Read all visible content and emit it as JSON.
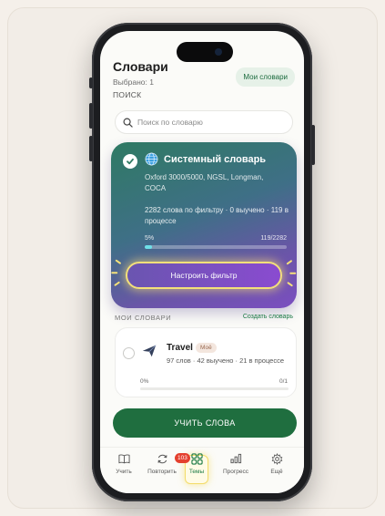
{
  "header": {
    "title": "Словари",
    "subtitle": "Выбрано: 1",
    "mine_button": "Мои словари"
  },
  "search": {
    "section_label": "ПОИСК",
    "placeholder": "Поиск по словарю"
  },
  "system_dictionary": {
    "selected": true,
    "icon": "globe-icon",
    "title": "Системный словарь",
    "description": "Oxford 3000/5000, NGSL, Longman, COCA",
    "stats": "2282 слова по фильтру · 0 выучено · 119 в процессе",
    "percent_label": "5%",
    "count_label": "119/2282",
    "progress": 0.05,
    "filter_button": "Настроить фильтр"
  },
  "my_dictionaries": {
    "section_label": "МОИ СЛОВАРИ",
    "create_link": "Создать словарь",
    "items": [
      {
        "icon": "airplane-icon",
        "name": "Travel",
        "tag": "Моё",
        "stats": "97 слов · 42 выучено · 21 в процессе",
        "percent_label": "0%",
        "count_label": "0/1",
        "progress": 0.0,
        "selected": false
      }
    ]
  },
  "learn_button": "УЧИТЬ СЛОВА",
  "nav": {
    "items": [
      {
        "label": "Учить",
        "icon": "book-icon"
      },
      {
        "label": "Повторить",
        "icon": "refresh-icon",
        "badge": "103"
      },
      {
        "label": "Темы",
        "icon": "grid-icon",
        "active": true
      },
      {
        "label": "Прогресс",
        "icon": "bar-chart-icon"
      },
      {
        "label": "Ещё",
        "icon": "gear-icon"
      }
    ]
  },
  "colors": {
    "primary_green": "#1f6e3f",
    "accent_highlight": "#f3e07a",
    "badge_red": "#e4402e"
  }
}
